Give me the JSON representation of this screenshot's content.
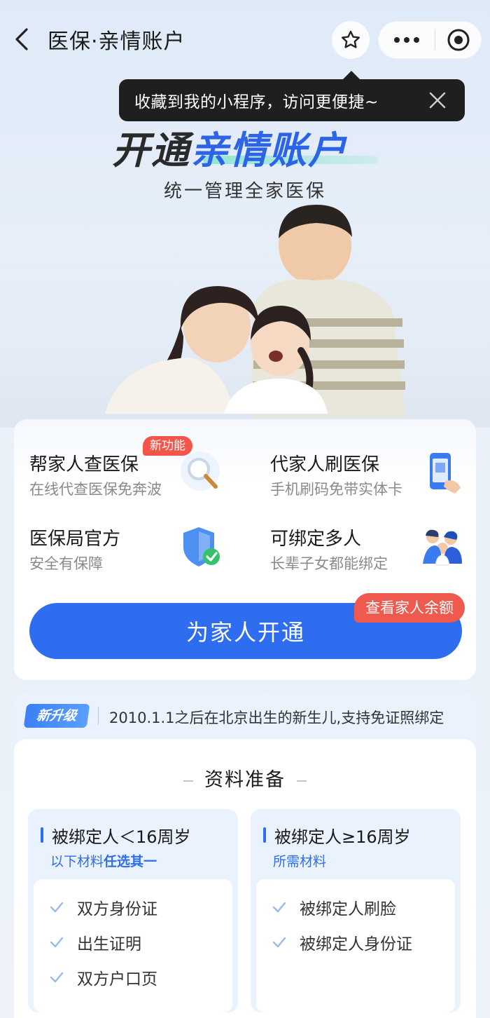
{
  "nav": {
    "title": "医保·亲情账户"
  },
  "tooltip": {
    "text": "收藏到我的小程序，访问更便捷~"
  },
  "hero": {
    "title_part1": "开通",
    "title_part2": "亲情账户",
    "subtitle": "统一管理全家医保"
  },
  "features": {
    "items": [
      {
        "title": "帮家人查医保",
        "subtitle": "在线代查医保免奔波",
        "icon": "magnifier-icon",
        "badge": "新功能"
      },
      {
        "title": "代家人刷医保",
        "subtitle": "手机刷码免带实体卡",
        "icon": "phone-qr-icon"
      },
      {
        "title": "医保局官方",
        "subtitle": "安全有保障",
        "icon": "shield-check-icon"
      },
      {
        "title": "可绑定多人",
        "subtitle": "长辈子女都能绑定",
        "icon": "family-icon"
      }
    ],
    "open_button": "为家人开通",
    "balance_tag": "查看家人余额"
  },
  "info": {
    "upgrade_badge": "新升级",
    "upgrade_text": "2010.1.1之后在北京出生的新生儿,支持免证照绑定",
    "prep_title": "资料准备",
    "under16": {
      "heading": "被绑定人＜16周岁",
      "sub_prefix": "以下材料",
      "sub_emphasis": "任选其一",
      "items": [
        "双方身份证",
        "出生证明",
        "双方户口页"
      ]
    },
    "over16": {
      "heading": "被绑定人≥16周岁",
      "sub": "所需材料",
      "items": [
        "被绑定人刷脸",
        "被绑定人身份证"
      ]
    }
  },
  "colors": {
    "primary": "#2f6df0",
    "badge_red": "#ef5a4f",
    "tooltip_bg": "#1f1f1f"
  }
}
